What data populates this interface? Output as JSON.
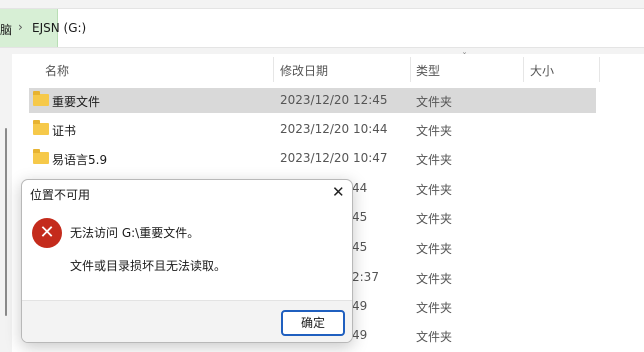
{
  "address": {
    "crumb_prev": "脑",
    "separator": "›",
    "current": "EJSN (G:)"
  },
  "columns": {
    "name": "名称",
    "modified": "修改日期",
    "type": "类型",
    "size": "大小",
    "sort_indicator": "ˇ"
  },
  "files": [
    {
      "name": "重要文件",
      "modified": "2023/12/20 12:45",
      "type": "文件夹"
    },
    {
      "name": "证书",
      "modified": "2023/12/20 10:44",
      "type": "文件夹"
    },
    {
      "name": "易语言5.9",
      "modified": "2023/12/20 10:47",
      "type": "文件夹"
    },
    {
      "name": "",
      "modified": "44",
      "type": "文件夹"
    },
    {
      "name": "",
      "modified": "45",
      "type": "文件夹"
    },
    {
      "name": "",
      "modified": "45",
      "type": "文件夹"
    },
    {
      "name": "",
      "modified": "2:37",
      "type": "文件夹"
    },
    {
      "name": "",
      "modified": "49",
      "type": "文件夹"
    },
    {
      "name": "",
      "modified": "49",
      "type": "文件夹"
    }
  ],
  "dialog": {
    "title": "位置不可用",
    "close_glyph": "✕",
    "error_glyph": "✕",
    "message": "无法访问 G:\\重要文件。",
    "detail": "文件或目录损坏且无法读取。",
    "ok_label": "确定"
  },
  "colors": {
    "selection": "#d9d9d9",
    "folder": "#f6c94a",
    "error": "#c42b1c",
    "button_border": "#1f5fbf"
  }
}
